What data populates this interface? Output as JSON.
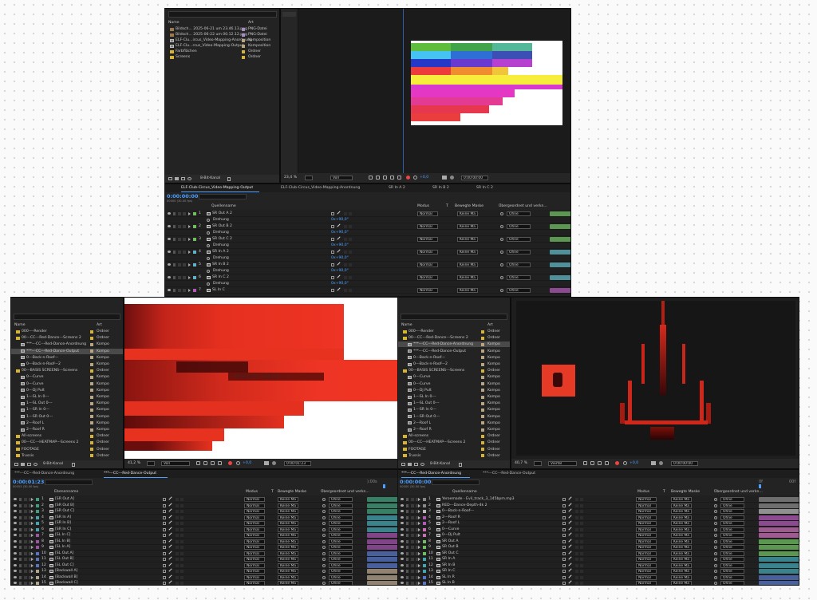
{
  "s1": {
    "project_cols": {
      "name": "Name",
      "type": "Art"
    },
    "project_items": [
      {
        "name": "Bildsch... 2025-06-21 um 23.46.13.png",
        "type": "PNG-Datei",
        "kind": "img"
      },
      {
        "name": "Bildsch... 2025-06-22 um 00.12.12.png",
        "type": "PNG-Datei",
        "kind": "img"
      },
      {
        "name": "ELF-Clu...ircus_Video-Mapping-Anordnung",
        "type": "Komposition",
        "kind": "comp"
      },
      {
        "name": "ELF-Clu...rcus_Video-Mapping-Output",
        "type": "Komposition",
        "kind": "comp"
      },
      {
        "name": "Farbflächen",
        "type": "Ordner",
        "kind": "fold"
      },
      {
        "name": "Screens",
        "type": "Ordner",
        "kind": "fold"
      }
    ],
    "bit_depth": "8-Bit-Kanal",
    "zoom": "23,4 %",
    "quality": "Voll",
    "exposure": "+0,0",
    "timecode": "0:00:00:00",
    "tabs": [
      "ELF-Club-Circus_Video-Mapping-Output",
      "ELF-Club-Circus_Video-Mapping-Anordnung",
      "SR In A 2",
      "SR In B 2",
      "SR In C 2"
    ],
    "time": "0:00:00:00",
    "frames": "00000 (30.00 fps)",
    "cols": {
      "modus": "Modus",
      "t": "T",
      "bm": "Bewegte Maske",
      "parent": "Übergeordnet und verkn..."
    },
    "layers": [
      {
        "num": "1",
        "name": "SR Out A 2",
        "color": "#6fbf62",
        "sub": "Drehung",
        "val": "0x+90,0°"
      },
      {
        "num": "2",
        "name": "SR Out B 2",
        "color": "#6fbf62",
        "sub": "Drehung",
        "val": "0x+90,0°"
      },
      {
        "num": "3",
        "name": "SR Out C 2",
        "color": "#6fbf62",
        "sub": "Drehung",
        "val": "0x+90,0°"
      },
      {
        "num": "4",
        "name": "SR In A 2",
        "color": "#5fb5c4",
        "sub": "Drehung",
        "val": "0x+90,0°"
      },
      {
        "num": "5",
        "name": "SR In B 2",
        "color": "#5fb5c4",
        "sub": "Drehung",
        "val": "0x+90,0°"
      },
      {
        "num": "6",
        "name": "SR In C 2",
        "color": "#5fb5c4",
        "sub": "Drehung",
        "val": "0x+90,0°"
      },
      {
        "num": "7",
        "name": "SL In C",
        "color": "#b05ab6",
        "sub": "",
        "val": ""
      }
    ],
    "mode": "Normal",
    "mask": "Keine Ma",
    "parent": "Ohne"
  },
  "s2": {
    "project_cols": {
      "name": "Name",
      "type": "Art"
    },
    "items": [
      {
        "name": "000----Render",
        "type": "Ordner",
        "kind": "fold",
        "ind": 0
      },
      {
        "name": "00---CC---Red-Dance---Screens 2",
        "type": "Ordner",
        "kind": "fold",
        "ind": 0
      },
      {
        "name": "***---CC---Red-Dance-Anordnung",
        "type": "Kompo",
        "kind": "comp",
        "ind": 1
      },
      {
        "name": "***---CC---Red-Dance-Output",
        "type": "Kompo",
        "kind": "comp",
        "ind": 1,
        "sel": true
      },
      {
        "name": "0---Back-n-Roof---",
        "type": "Kompo",
        "kind": "comp",
        "ind": 1
      },
      {
        "name": "0---Back-n-Roof---2",
        "type": "Kompo",
        "kind": "comp",
        "ind": 1
      },
      {
        "name": "00---BASIS SCREENS---Screens",
        "type": "Ordner",
        "kind": "fold",
        "ind": 0
      },
      {
        "name": "0---Curve",
        "type": "Kompo",
        "kind": "comp",
        "ind": 1
      },
      {
        "name": "0---Curve",
        "type": "Kompo",
        "kind": "comp",
        "ind": 1
      },
      {
        "name": "0---Dj Pult",
        "type": "Kompo",
        "kind": "comp",
        "ind": 1
      },
      {
        "name": "1---SL In 0---",
        "type": "Kompo",
        "kind": "comp",
        "ind": 1
      },
      {
        "name": "1---SL Out 0---",
        "type": "Kompo",
        "kind": "comp",
        "ind": 1
      },
      {
        "name": "1---SR In 0---",
        "type": "Kompo",
        "kind": "comp",
        "ind": 1
      },
      {
        "name": "1---SR Out 0---",
        "type": "Kompo",
        "kind": "comp",
        "ind": 1
      },
      {
        "name": "2---Roof L",
        "type": "Kompo",
        "kind": "comp",
        "ind": 1
      },
      {
        "name": "2---Roof R",
        "type": "Kompo",
        "kind": "comp",
        "ind": 1
      },
      {
        "name": "All-screens",
        "type": "Ordner",
        "kind": "fold",
        "ind": 0
      },
      {
        "name": "00---CC---HEATMAP---Screens 2",
        "type": "Ordner",
        "kind": "fold",
        "ind": 0
      },
      {
        "name": "FOOTAGE",
        "type": "Ordner",
        "kind": "fold",
        "ind": 0
      },
      {
        "name": "Trussis",
        "type": "Ordner",
        "kind": "fold",
        "ind": 0
      }
    ],
    "bit_depth": "8-Bit-Kanal",
    "zoom": "41,2 %",
    "quality": "Voll",
    "exposure": "+0,0",
    "timecode": "0:00:01:23",
    "viewer_text": "AMAZING DANCE",
    "tabs": [
      "***---CC---Red-Dance-Anordnung",
      "***---CC---Red-Dance-Output"
    ],
    "time": "0:00:01:23",
    "frames": "00053 (30.00 fps)",
    "cols": {
      "name": "Ebenenname",
      "modus": "Modus",
      "t": "T",
      "bm": "Bewegte Maske",
      "parent": "Übergeordnet und verkn..."
    },
    "layers": [
      {
        "num": "1",
        "name": "[SR Out A]",
        "color": "#3fa07e"
      },
      {
        "num": "2",
        "name": "[SR Out B]",
        "color": "#3fa07e"
      },
      {
        "num": "3",
        "name": "[SR Out C]",
        "color": "#3fa07e"
      },
      {
        "num": "4",
        "name": "[SR In A]",
        "color": "#44a4b0"
      },
      {
        "num": "5",
        "name": "[SR In B]",
        "color": "#44a4b0"
      },
      {
        "num": "6",
        "name": "[SR In C]",
        "color": "#44a4b0"
      },
      {
        "num": "7",
        "name": "[SL In C]",
        "color": "#a052a8"
      },
      {
        "num": "8",
        "name": "[SL In B]",
        "color": "#a052a8"
      },
      {
        "num": "9",
        "name": "[SL In A]",
        "color": "#a052a8"
      },
      {
        "num": "10",
        "name": "[SL Out A]",
        "color": "#5675c4"
      },
      {
        "num": "11",
        "name": "[SL Out B]",
        "color": "#5675c4"
      },
      {
        "num": "12",
        "name": "[SL Out C]",
        "color": "#5675c4"
      },
      {
        "num": "13",
        "name": "[Backwall A]",
        "color": "#b5a48c"
      },
      {
        "num": "14",
        "name": "[Backwall B]",
        "color": "#b5a48c"
      },
      {
        "num": "15",
        "name": "[Backwall C]",
        "color": "#b5a48c"
      }
    ],
    "mode": "Normal",
    "mask": "Keine Ma",
    "parent": "Ohne",
    "ruler": "):00s"
  },
  "s3": {
    "project_cols": {
      "name": "Name",
      "type": "Art"
    },
    "items": [
      {
        "name": "000----Render",
        "type": "Ordner",
        "kind": "fold",
        "ind": 0
      },
      {
        "name": "00---CC---Red-Dance---Screens 2",
        "type": "Ordner",
        "kind": "fold",
        "ind": 0
      },
      {
        "name": "***---CC---Red-Dance-Anordnung",
        "type": "Kompo",
        "kind": "comp",
        "ind": 1,
        "sel": true
      },
      {
        "name": "***---CC---Red-Dance-Output",
        "type": "Kompo",
        "kind": "comp",
        "ind": 1
      },
      {
        "name": "0---Back-n-Roof---",
        "type": "Kompo",
        "kind": "comp",
        "ind": 1
      },
      {
        "name": "0---Back-n-Roof---2",
        "type": "Kompo",
        "kind": "comp",
        "ind": 1
      },
      {
        "name": "00---BASIS SCREENS---Screens",
        "type": "Ordner",
        "kind": "fold",
        "ind": 0
      },
      {
        "name": "0---Curve",
        "type": "Kompo",
        "kind": "comp",
        "ind": 1
      },
      {
        "name": "0---Curve",
        "type": "Kompo",
        "kind": "comp",
        "ind": 1
      },
      {
        "name": "0---Dj Pult",
        "type": "Kompo",
        "kind": "comp",
        "ind": 1
      },
      {
        "name": "1---SL In 0---",
        "type": "Kompo",
        "kind": "comp",
        "ind": 1
      },
      {
        "name": "1---SL Out 0---",
        "type": "Kompo",
        "kind": "comp",
        "ind": 1
      },
      {
        "name": "1---SR In 0---",
        "type": "Kompo",
        "kind": "comp",
        "ind": 1
      },
      {
        "name": "1---SR Out 0---",
        "type": "Kompo",
        "kind": "comp",
        "ind": 1
      },
      {
        "name": "2---Roof L",
        "type": "Kompo",
        "kind": "comp",
        "ind": 1
      },
      {
        "name": "2---Roof R",
        "type": "Kompo",
        "kind": "comp",
        "ind": 1
      },
      {
        "name": "All-screens",
        "type": "Ordner",
        "kind": "fold",
        "ind": 0
      },
      {
        "name": "00---CC---HEATMAP---Screens 2",
        "type": "Ordner",
        "kind": "fold",
        "ind": 0
      },
      {
        "name": "FOOTAGE",
        "type": "Ordner",
        "kind": "fold",
        "ind": 0
      },
      {
        "name": "Trussis",
        "type": "Ordner",
        "kind": "fold",
        "ind": 0
      }
    ],
    "bit_depth": "8-Bit-Kanal",
    "zoom": "40,7 %",
    "quality": "Viertel",
    "exposure": "+0,0",
    "timecode": "0:00:00:00",
    "tabs": [
      "***---CC---Red-Dance-Anordnung",
      "***---CC---Red-Dance-Output"
    ],
    "time": "0:00:00:00",
    "frames": "00000 (30.00 fps)",
    "cols": {
      "name": "Quellenname",
      "modus": "Modus",
      "t": "T",
      "bm": "Bewegte Maske",
      "parent": "Übergeordnet und verkn..."
    },
    "layers": [
      {
        "num": "1",
        "name": "Yeroemade - Evil_track_3_145bpm.mp3",
        "color": "#888888"
      },
      {
        "num": "2",
        "name": "RED---Dance-Depth-4k 2",
        "color": "#888888"
      },
      {
        "num": "3",
        "name": "0---Back-n-Roof---",
        "color": "#b5b5b5"
      },
      {
        "num": "4",
        "name": "2---Roof R",
        "color": "#b05ab6"
      },
      {
        "num": "5",
        "name": "2---Roof L",
        "color": "#b05ab6"
      },
      {
        "num": "6",
        "name": "0---Curve",
        "color": "#c86fb4"
      },
      {
        "num": "7",
        "name": "0---Dj Pult",
        "color": "#c86fb4"
      },
      {
        "num": "8",
        "name": "SR Out A",
        "color": "#6fbf62"
      },
      {
        "num": "9",
        "name": "SR Out B",
        "color": "#6fbf62"
      },
      {
        "num": "10",
        "name": "SR Out C",
        "color": "#6fbf62"
      },
      {
        "num": "11",
        "name": "SR In A",
        "color": "#44a4b0"
      },
      {
        "num": "12",
        "name": "SR In B",
        "color": "#44a4b0"
      },
      {
        "num": "13",
        "name": "SR In C",
        "color": "#44a4b0"
      },
      {
        "num": "14",
        "name": "SL In R",
        "color": "#5675c4"
      },
      {
        "num": "15",
        "name": "SL In B",
        "color": "#5675c4"
      }
    ],
    "mode": "Normal",
    "mask": "Keine Ma",
    "parent": "Ohne",
    "ruler_a": "0f",
    "ruler_b": "00f"
  }
}
